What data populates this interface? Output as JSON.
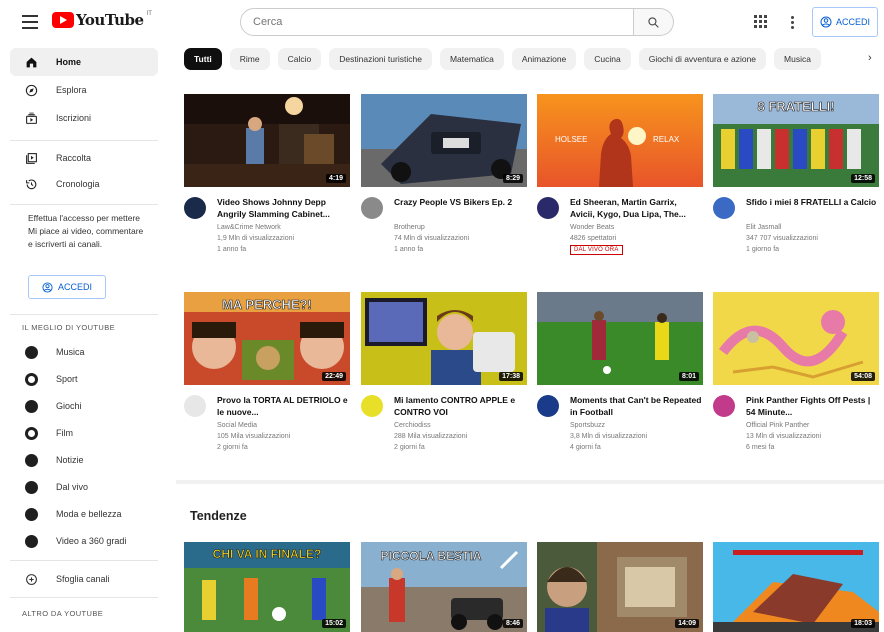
{
  "header": {
    "logo_text": "YouTube",
    "logo_sup": "IT",
    "search_placeholder": "Cerca",
    "signin_label": "ACCEDI"
  },
  "sidebar": {
    "primary": [
      {
        "label": "Home",
        "icon": "home-icon",
        "active": true
      },
      {
        "label": "Esplora",
        "icon": "compass-icon"
      },
      {
        "label": "Iscrizioni",
        "icon": "subscriptions-icon"
      }
    ],
    "library": [
      {
        "label": "Raccolta",
        "icon": "library-icon"
      },
      {
        "label": "Cronologia",
        "icon": "history-icon"
      }
    ],
    "signin_prompt": "Effettua l'accesso per mettere Mi piace ai video, commentare e iscriverti ai canali.",
    "signin_label": "ACCEDI",
    "best_title": "IL MEGLIO DI YOUTUBE",
    "categories": [
      {
        "label": "Musica",
        "icon": "music-icon"
      },
      {
        "label": "Sport",
        "icon": "sport-icon"
      },
      {
        "label": "Giochi",
        "icon": "gaming-icon"
      },
      {
        "label": "Film",
        "icon": "film-icon"
      },
      {
        "label": "Notizie",
        "icon": "news-icon"
      },
      {
        "label": "Dal vivo",
        "icon": "live-icon"
      },
      {
        "label": "Moda e bellezza",
        "icon": "fashion-icon"
      },
      {
        "label": "Video a 360 gradi",
        "icon": "360-icon"
      }
    ],
    "browse_label": "Sfoglia canali",
    "more_title": "ALTRO DA YOUTUBE"
  },
  "chips": [
    "Tutti",
    "Rime",
    "Calcio",
    "Destinazioni turistiche",
    "Matematica",
    "Animazione",
    "Cucina",
    "Giochi di avventura e azione",
    "Musica"
  ],
  "videos": [
    {
      "title": "Video Shows Johnny Depp Angrily Slamming Cabinet...",
      "channel": "Law&Crime Network",
      "views": "1,9 Mln di visualizzazioni",
      "ago": "1 anno fa",
      "duration": "4:19",
      "thumb": "thumb-depp",
      "avatar_color": "#1a2a4a"
    },
    {
      "title": "Crazy People VS Bikers Ep. 2",
      "channel": "Brotherup",
      "views": "74 Mln di visualizzazioni",
      "ago": "1 anno fa",
      "duration": "8:29",
      "thumb": "thumb-bikers",
      "avatar_color": "#7a7a7a"
    },
    {
      "title": "Ed Sheeran, Martin Garrix, Avicii, Kygo, Dua Lipa, The...",
      "channel": "Wonder Beats",
      "views": "4826 spettatori",
      "ago": "",
      "duration": "",
      "live": "DAL VIVO ORA",
      "thumb": "thumb-sunset",
      "avatar_color": "#2a2a6a"
    },
    {
      "title": "Sfido i miei 8 FRATELLI a Calcio",
      "channel": "Elit Jasmall",
      "views": "347 707 visualizzazioni",
      "ago": "1 giorno fa",
      "duration": "12:58",
      "thumb": "thumb-fratelli",
      "avatar_color": "#3a6ac4"
    },
    {
      "title": "Provo la TORTA AL DETRIOLO e le nuove...",
      "channel": "Social Media",
      "views": "105 Mila visualizzazioni",
      "ago": "2 giorni fa",
      "duration": "22:49",
      "thumb": "thumb-perche",
      "avatar_color": "#e7e7e7"
    },
    {
      "title": "Mi lamento CONTRO APPLE e CONTRO VOI",
      "channel": "Cerchiodiss",
      "views": "288 Mila visualizzazioni",
      "ago": "2 giorni fa",
      "duration": "17:38",
      "thumb": "thumb-apple",
      "avatar_color": "#e8e028"
    },
    {
      "title": "Moments that Can't be Repeated in Football",
      "channel": "Sportsbuzz",
      "views": "3,8 Mln di visualizzazioni",
      "ago": "4 giorni fa",
      "duration": "8:01",
      "thumb": "thumb-football",
      "avatar_color": "#1a3a8a"
    },
    {
      "title": "Pink Panther Fights Off Pests | 54 Minute...",
      "channel": "Official Pink Panther",
      "views": "13 Mln di visualizzazioni",
      "ago": "6 mesi fa",
      "duration": "54:08",
      "thumb": "thumb-panther",
      "avatar_color": "#c23a8a"
    },
    {
      "title": "",
      "channel": "",
      "views": "",
      "ago": "",
      "duration": "15:02",
      "thumb": "thumb-finale"
    },
    {
      "title": "",
      "channel": "",
      "views": "",
      "ago": "",
      "duration": "8:46",
      "thumb": "thumb-bestia"
    },
    {
      "title": "",
      "channel": "",
      "views": "",
      "ago": "",
      "duration": "14:09",
      "thumb": "thumb-vlog"
    },
    {
      "title": "",
      "channel": "",
      "views": "",
      "ago": "",
      "duration": "18:03",
      "thumb": "thumb-game"
    }
  ],
  "trending_title": "Tendenze",
  "thumb_texts": {
    "fratelli": "8 FRATELLI!",
    "perche": "MA PERCHE?!",
    "finale": "CHI VA IN FINALE?",
    "bestia": "PICCOLA BESTIA",
    "sunset_left": "HOLSEE",
    "sunset_right": "RELAX"
  }
}
